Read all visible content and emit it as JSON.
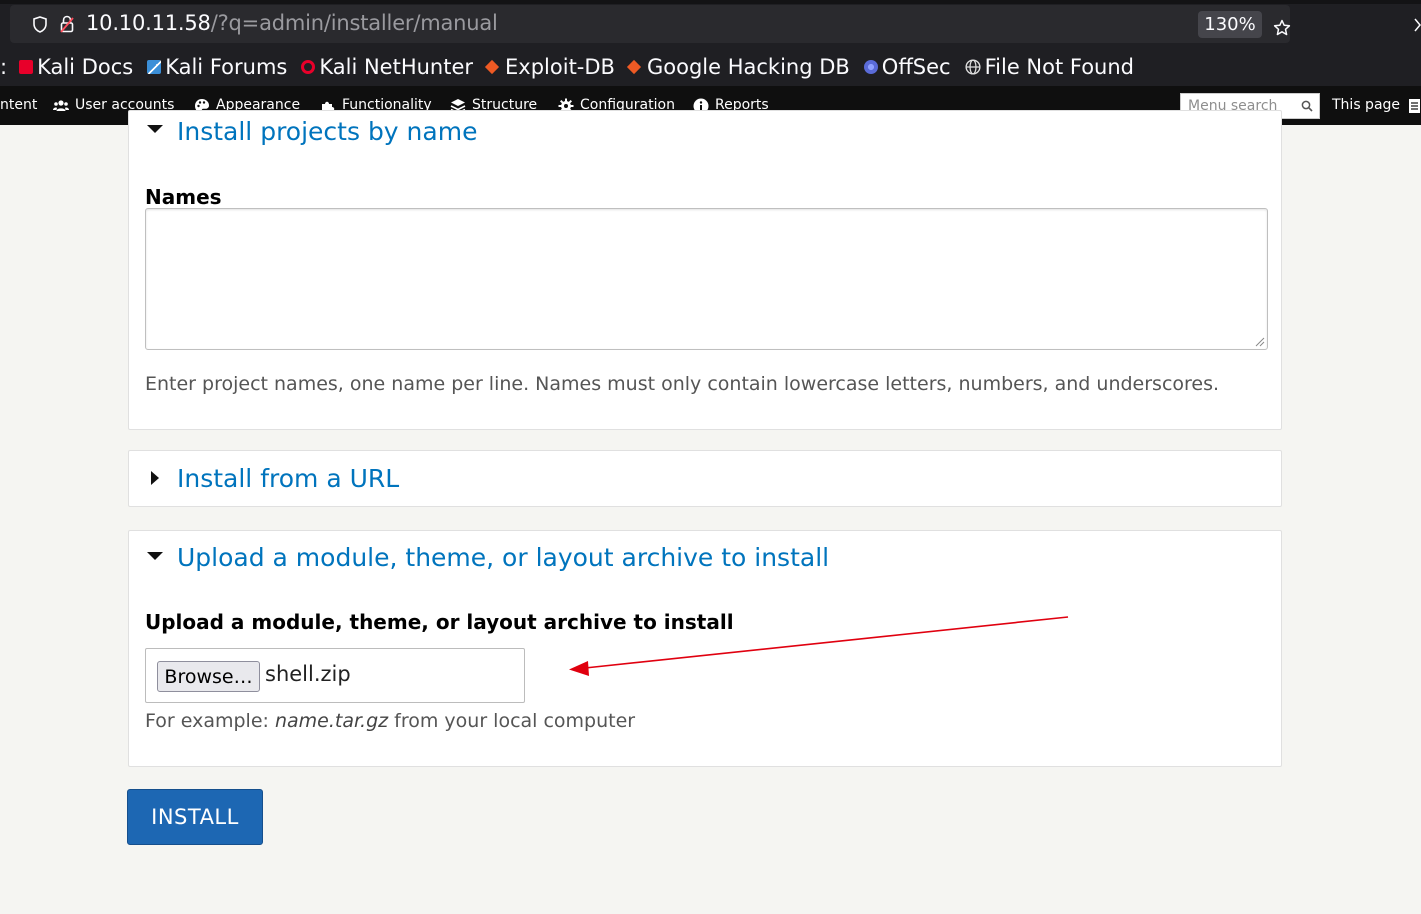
{
  "browser": {
    "url_host": "10.10.11.58",
    "url_path": "/?q=admin/installer/manual",
    "zoom": "130%"
  },
  "bookmarks": [
    {
      "label": "Kali Docs",
      "icon": "kali-docs-icon",
      "color": "#e8002a"
    },
    {
      "label": "Kali Forums",
      "icon": "kali-forums-icon",
      "color": "#3b8fd8"
    },
    {
      "label": "Kali NetHunter",
      "icon": "kali-nethunter-icon",
      "color": "#e8002a"
    },
    {
      "label": "Exploit-DB",
      "icon": "exploit-db-icon",
      "color": "#ee5a24"
    },
    {
      "label": "Google Hacking DB",
      "icon": "ghdb-icon",
      "color": "#ee5a24"
    },
    {
      "label": "OffSec",
      "icon": "offsec-icon",
      "color": "#5a6bd8"
    },
    {
      "label": "File Not Found",
      "icon": "globe-icon",
      "color": "#dddddd"
    }
  ],
  "toolbar": {
    "items": [
      {
        "label": "ntent",
        "icon": ""
      },
      {
        "label": "User accounts",
        "icon": "users-icon"
      },
      {
        "label": "Appearance",
        "icon": "palette-icon"
      },
      {
        "label": "Functionality",
        "icon": "puzzle-icon"
      },
      {
        "label": "Structure",
        "icon": "layers-icon"
      },
      {
        "label": "Configuration",
        "icon": "gear-icon"
      },
      {
        "label": "Reports",
        "icon": "info-icon"
      }
    ],
    "search_placeholder": "Menu search",
    "this_page": "This page"
  },
  "install_by_name": {
    "legend": "Install projects by name",
    "field_label": "Names",
    "value": "",
    "description": "Enter project names, one name per line. Names must only contain lowercase letters, numbers, and underscores."
  },
  "install_from_url": {
    "legend": "Install from a URL"
  },
  "upload_archive": {
    "legend": "Upload a module, theme, or layout archive to install",
    "field_label": "Upload a module, theme, or layout archive to install",
    "browse_label": "Browse…",
    "file_name": "shell.zip",
    "description_prefix": "For example: ",
    "description_example": "name.tar.gz",
    "description_suffix": " from your local computer"
  },
  "actions": {
    "install_label": "INSTALL"
  },
  "colors": {
    "link": "#0074bd",
    "primary_button": "#1d67b3",
    "annotation_arrow": "#e0000f"
  }
}
